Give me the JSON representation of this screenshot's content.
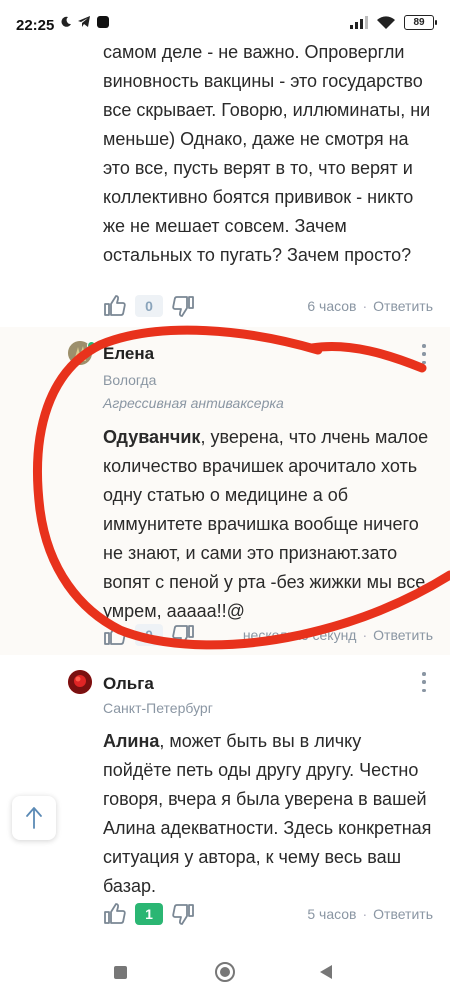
{
  "status_bar": {
    "time": "22:25",
    "battery": "89"
  },
  "comments": [
    {
      "text": "самом деле - не важно. Опровергли виновность вакцины - это государство все скрывает. Говорю, иллюминаты, ни меньше) Однако, даже не смотря на это все, пусть верят в то, что верят и коллективно боятся прививок - никто же не мешает совсем. Зачем остальных то пугать? Зачем просто?",
      "likes": "0",
      "time": "6 часов",
      "reply_label": "Ответить"
    },
    {
      "author": "Елена",
      "city": "Вологда",
      "badge": "Агрессивная антиваксерка",
      "mention": "Одуванчик",
      "text": ", уверена, что лчень малое количество врачишек арочитало хоть одну статью о медицине а об иммунитете врачишка вообще ничего не знают, и сами это признают.зато вопят с пеной у рта -без жижки мы все умрем, ааааа!!@",
      "likes": "0",
      "time": "несколько секунд",
      "reply_label": "Ответить"
    },
    {
      "author": "Ольга",
      "city": "Санкт-Петербург",
      "mention": "Алина",
      "text": ", может быть вы в личку пойдёте петь оды другу другу. Честно говоря, вчера я была уверена в вашей Алина адекватности. Здесь конкретная ситуация у автора, к чему весь ваш базар.",
      "likes": "1",
      "time": "5 часов",
      "reply_label": "Ответить"
    }
  ],
  "colors": {
    "accent_green": "#2bb673",
    "annotation_red": "#e8321c",
    "online_dot": "#2bb673"
  },
  "icons": [
    "thumbs-up-icon",
    "thumbs-down-icon",
    "more-vert-icon",
    "arrow-up-icon",
    "wifi-icon",
    "signal-icon",
    "moon-icon",
    "telegram-icon"
  ]
}
